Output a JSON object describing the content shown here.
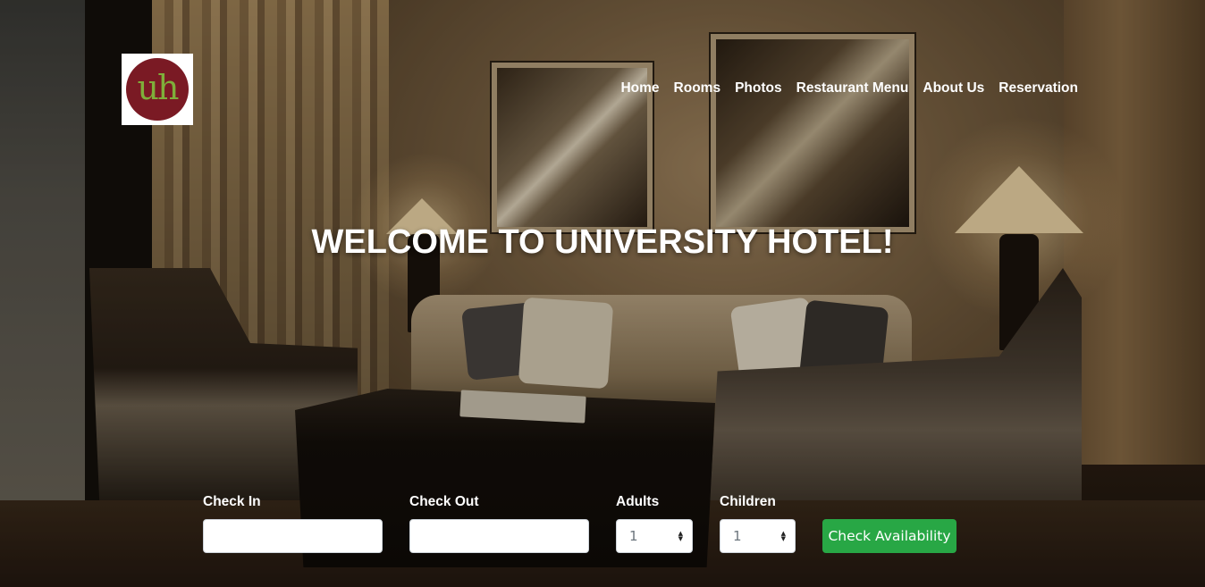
{
  "header": {
    "logo_text": "uh",
    "nav": [
      "Home",
      "Rooms",
      "Photos",
      "Restaurant Menu",
      "About Us",
      "Reservation"
    ]
  },
  "hero": {
    "title": "WELCOME TO UNIVERSITY HOTEL!"
  },
  "booking": {
    "check_in": {
      "label": "Check In",
      "value": ""
    },
    "check_out": {
      "label": "Check Out",
      "value": ""
    },
    "adults": {
      "label": "Adults",
      "value": "1"
    },
    "children": {
      "label": "Children",
      "value": "1"
    },
    "submit_label": "Check Availability"
  },
  "colors": {
    "button": "#28a745",
    "logo_circle": "#7a1a24",
    "logo_letters": "#7fae3a"
  }
}
